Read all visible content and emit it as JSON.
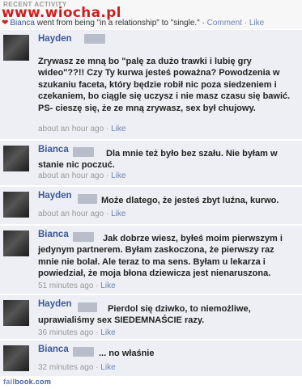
{
  "header": {
    "recent_activity": "RECENT ACTIVITY",
    "watermark": "www.wiocha.pl",
    "status": {
      "name": "Bianca",
      "text": " went from being \"in a relationship\" to \"single.\" · ",
      "comment_link": "Comment",
      "separator": " · ",
      "like_link": "Like"
    }
  },
  "comments": [
    {
      "author": "Hayden",
      "text": "Zrywasz ze mną bo \"palę za dużo trawki i lubię gry wideo\"??!! Czy Ty kurwa jesteś poważna? Powodzenia w szukaniu faceta, który będzie robił nic poza siedzeniem i czekaniem, bo ciągle się uczysz i nie masz czasu się bawić. PS- cieszę się, że ze mną zrywasz, sex był chujowy.",
      "time": "about an hour ago",
      "like": "Like"
    },
    {
      "author": "Bianca",
      "text": "Dla mnie też było bez szału. Nie byłam w stanie nic poczuć.",
      "time": "about an hour ago",
      "like": "Like"
    },
    {
      "author": "Hayden",
      "text": "Może dlatego, że jesteś zbyt luźna, kurwo.",
      "time": "about an hour ago",
      "like": "Like"
    },
    {
      "author": "Bianca",
      "text": "Jak dobrze wiesz, byłeś moim pierwszym i jedynym partnerem. Byłam zaskoczona, że pierwszy raz mnie nie bolał. Ale teraz to ma sens. Byłam u lekarza i powiedział, że moja błona dziewicza jest nienaruszona.",
      "time": "51 minutes ago",
      "like": "Like"
    },
    {
      "author": "Hayden",
      "text": "Pierdol się dziwko, to niemożliwe, uprawialiśmy sex SIEDEMNAŚCIE razy.",
      "time": "36 minutes ago",
      "like": "Like"
    },
    {
      "author": "Bianca",
      "text": "... no właśnie",
      "time": "32 minutes ago",
      "like": "Like"
    }
  ],
  "footer": {
    "prefix": "fail",
    "suffix": "book.com"
  }
}
